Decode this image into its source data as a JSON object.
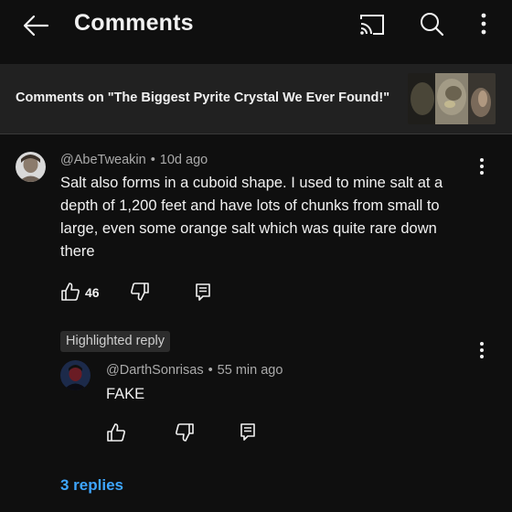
{
  "header": {
    "title": "Comments",
    "icons": [
      "back-arrow-icon",
      "cast-icon",
      "search-icon",
      "more-vert-icon"
    ]
  },
  "video": {
    "comments_on_label": "Comments on \"The Biggest Pyrite Crystal We Ever Found!\""
  },
  "comment": {
    "author": "@AbeTweakin",
    "separator": "•",
    "time": "10d ago",
    "text": "Salt also forms in a cuboid shape. I used to mine salt at a depth of 1,200 feet and have lots of chunks from small to large, even some orange salt which was quite rare down there",
    "likes": "46",
    "icons": [
      "thumb-up-icon",
      "thumb-down-icon",
      "reply-icon",
      "more-vert-icon"
    ]
  },
  "highlighted_reply": {
    "badge": "Highlighted reply",
    "author": "@DarthSonrisas",
    "separator": "•",
    "time": "55 min ago",
    "text": "FAKE",
    "icons": [
      "thumb-up-icon",
      "thumb-down-icon",
      "reply-icon",
      "more-vert-icon"
    ]
  },
  "replies_link": "3 replies",
  "colors": {
    "background": "#0f0f0f",
    "video_bar": "#212121",
    "link": "#3ea6ff",
    "text_primary": "#f1f1f1",
    "text_secondary": "#aaaaaa"
  }
}
